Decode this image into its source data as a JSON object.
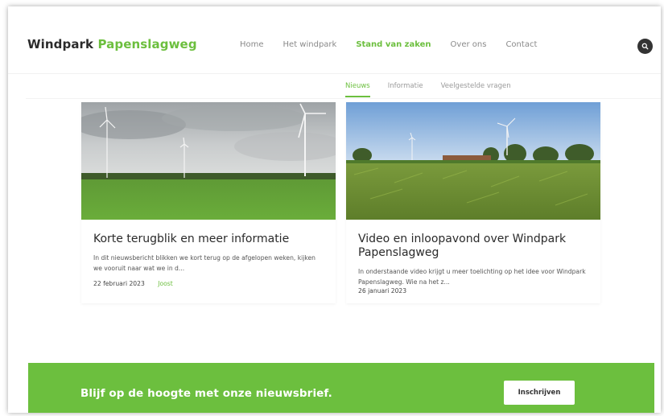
{
  "brand": {
    "name_part1": "Windpark",
    "name_part2": "Papenslagweg"
  },
  "nav": {
    "items": [
      {
        "label": "Home",
        "active": false
      },
      {
        "label": "Het windpark",
        "active": false
      },
      {
        "label": "Stand van zaken",
        "active": true
      },
      {
        "label": "Over ons",
        "active": false
      },
      {
        "label": "Contact",
        "active": false
      }
    ]
  },
  "subnav": {
    "items": [
      {
        "label": "Nieuws",
        "active": true
      },
      {
        "label": "Informatie",
        "active": false
      },
      {
        "label": "Veelgestelde vragen",
        "active": false
      }
    ]
  },
  "posts": [
    {
      "title": "Korte terugblik en meer informatie",
      "excerpt": "In dit nieuwsbericht blikken we kort terug op de afgelopen weken, kijken we vooruit naar wat we in d...",
      "date": "22 februari 2023",
      "author": "Joost"
    },
    {
      "title": "Video en inloopavond over Windpark Papenslagweg",
      "excerpt": "In onderstaande video krijgt u meer toelichting op het idee voor Windpark Papenslagweg. Wie na het z...",
      "date": "26 januari 2023",
      "author": ""
    }
  ],
  "newsletter": {
    "text": "Blijf op de hoogte met onze nieuwsbrief.",
    "button_label": "Inschrijven"
  },
  "colors": {
    "accent": "#6cbf3e",
    "dark": "#2b2b2b"
  },
  "icons": {
    "search": "search-icon"
  }
}
